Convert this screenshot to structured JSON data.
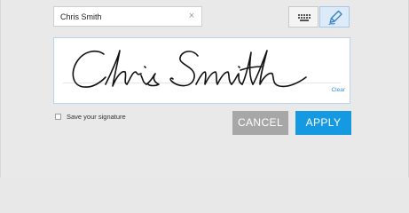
{
  "name_field": {
    "value": "Chris Smith",
    "clear_icon": "close-icon",
    "clear_glyph": "×"
  },
  "mode_toggle": {
    "keyboard_icon": "keyboard-icon",
    "draw_icon": "pen-icon",
    "active": "draw"
  },
  "signature": {
    "clear_label": "Clear"
  },
  "save_option": {
    "label": "Save your signature",
    "checked": false
  },
  "buttons": {
    "cancel_label": "CANCEL",
    "apply_label": "APPLY"
  },
  "colors": {
    "accent": "#159ae1",
    "cancel": "#a7a7a7",
    "link": "#3a8fd8",
    "background": "#e9e9e9"
  }
}
